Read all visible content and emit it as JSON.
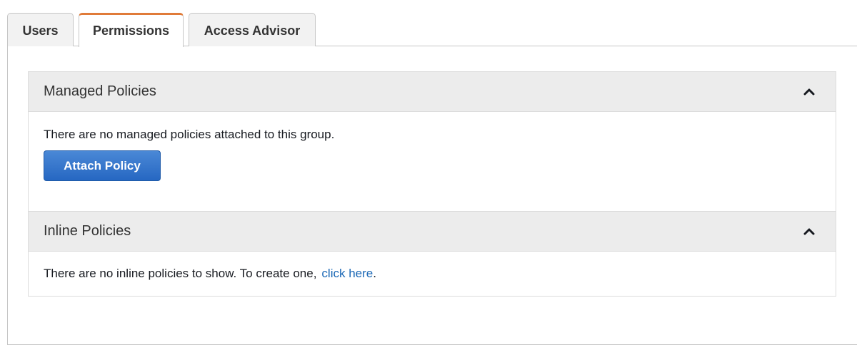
{
  "tabs": [
    {
      "label": "Users"
    },
    {
      "label": "Permissions",
      "active": true
    },
    {
      "label": "Access Advisor"
    }
  ],
  "managed_policies": {
    "title": "Managed Policies",
    "message": "There are no managed policies attached to this group.",
    "attach_button_label": "Attach Policy",
    "toggle_icon": "chevron-up-icon"
  },
  "inline_policies": {
    "title": "Inline Policies",
    "message": "There are no inline policies to show. To create one,",
    "link_label": "click here",
    "trailing_text": ".",
    "toggle_icon": "chevron-up-icon"
  },
  "colors": {
    "active_tab_accent": "#e07b39",
    "primary_button": "#2667c2",
    "link": "#1a67b5"
  }
}
